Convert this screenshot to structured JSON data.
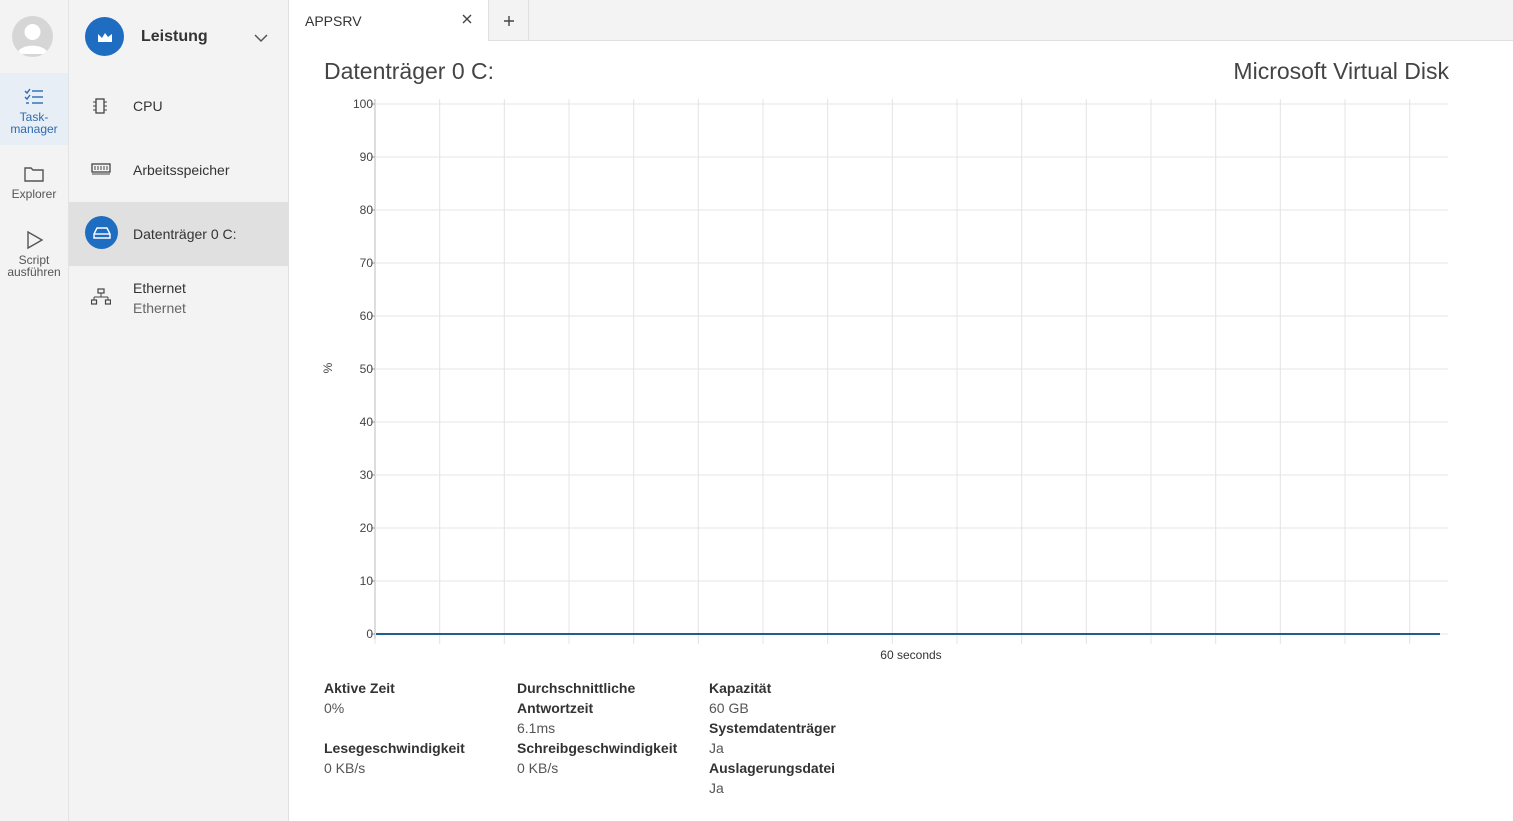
{
  "rail": {
    "items": [
      {
        "label_line1": "Task-",
        "label_line2": "manager",
        "icon": "tasklist-icon"
      },
      {
        "label_line1": "Explorer",
        "label_line2": "",
        "icon": "folder-icon"
      },
      {
        "label_line1": "Script",
        "label_line2": "ausführen",
        "icon": "play-icon"
      }
    ]
  },
  "nav": {
    "header_title": "Leistung",
    "items": [
      {
        "label": "CPU",
        "sublabel": "",
        "icon": "cpu-icon"
      },
      {
        "label": "Arbeitsspeicher",
        "sublabel": "",
        "icon": "memory-icon"
      },
      {
        "label": "Datenträger 0 C:",
        "sublabel": "",
        "icon": "disk-icon",
        "active": true
      },
      {
        "label": "Ethernet",
        "sublabel": "Ethernet",
        "icon": "network-icon"
      }
    ]
  },
  "tabs": [
    {
      "label": "APPSRV"
    }
  ],
  "main": {
    "title": "Datenträger 0 C:",
    "model": "Microsoft Virtual Disk"
  },
  "chart_data": {
    "type": "line",
    "title": "",
    "xlabel": "60 seconds",
    "ylabel": "%",
    "ylim": [
      0,
      100
    ],
    "yticks": [
      "0",
      "10",
      "20",
      "30",
      "40",
      "50",
      "60",
      "70",
      "80",
      "90",
      "100"
    ],
    "grid": true,
    "series": [
      {
        "values": [
          0,
          0,
          0,
          0,
          0,
          0,
          0,
          0,
          0,
          0,
          0,
          0,
          0,
          0,
          0,
          0,
          0,
          0,
          0,
          0,
          0,
          0,
          0,
          0,
          0,
          0,
          0,
          0,
          0,
          0,
          0,
          0,
          0,
          0,
          0,
          0,
          0,
          0,
          0,
          0,
          0,
          0,
          0,
          0,
          0,
          0,
          0,
          0,
          0,
          0,
          0,
          0,
          0,
          0,
          0,
          0,
          0,
          0,
          0,
          0
        ]
      }
    ]
  },
  "stats": {
    "active_time": {
      "label": "Aktive Zeit",
      "value": "0%"
    },
    "avg_response": {
      "label_line1": "Durchschnittliche",
      "label_line2": "Antwortzeit",
      "value": "6.1ms"
    },
    "capacity": {
      "label": "Kapazität",
      "value": "60 GB"
    },
    "system_disk": {
      "label": "Systemdatenträger",
      "value": "Ja"
    },
    "page_file": {
      "label": "Auslagerungsdatei",
      "value": "Ja"
    },
    "read_speed": {
      "label": "Lesegeschwindigkeit",
      "value": "0 KB/s"
    },
    "write_speed": {
      "label": "Schreibgeschwindigkeit",
      "value": "0 KB/s"
    }
  },
  "colors": {
    "accent": "#1f6dc0",
    "line": "#1f5f8b",
    "grid": "#e4e4e4"
  }
}
